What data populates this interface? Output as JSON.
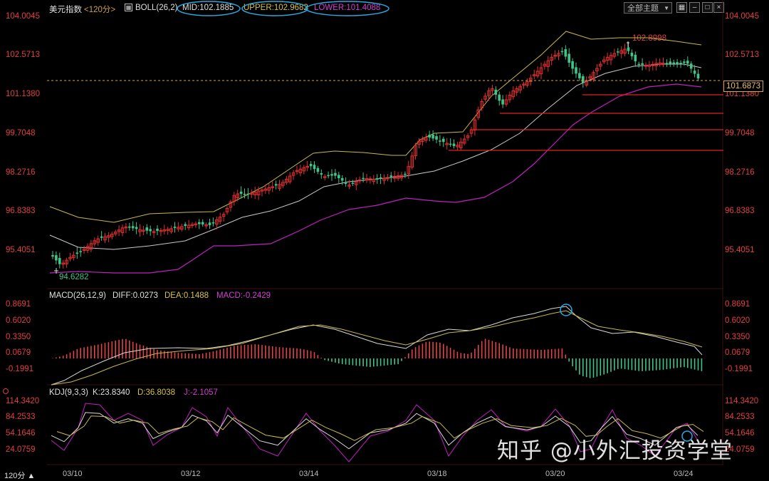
{
  "main_panel": {
    "indicator_name": "美元指数",
    "period": "<120分>",
    "boll_label": "BOLL(26,2)",
    "mid": "MID:102.1885",
    "upper": "UPPER:102.9682",
    "lower": "LOWER:101.4088",
    "high_annotation": "102.8998",
    "low_annotation": "94.6282",
    "current_price": "101.6873",
    "axis_left": [
      "104.0045",
      "102.5713",
      "101.1380",
      "99.7048",
      "98.2716",
      "96.8383",
      "95.4051"
    ],
    "axis_right": [
      "104.0045",
      "102.5713",
      "101.1380",
      "99.7048",
      "98.2716",
      "96.8383",
      "95.4051"
    ]
  },
  "toolbar": {
    "theme_select": "全部主题",
    "theme_arrow": "▼"
  },
  "macd_panel": {
    "label": "MACD(26,12,9)",
    "diff": "DIFF:0.0273",
    "dea": "DEA:0.1488",
    "macd": "MACD:-0.2429",
    "axis": [
      "0.8691",
      "0.6020",
      "0.3350",
      "0.0679",
      "-0.1991"
    ]
  },
  "kdj_panel": {
    "label": "KDJ(9,3,3)",
    "k": "K:23.8340",
    "d": "D:36.8038",
    "j": "J:-2.1057",
    "axis": [
      "114.3420",
      "84.2533",
      "54.1646",
      "24.0759"
    ]
  },
  "bottom_bar": {
    "period_button": "120分 ▲",
    "dates": [
      "03/10",
      "03/12",
      "03/14",
      "03/18",
      "03/20",
      "03/24"
    ]
  },
  "watermark": "知乎 @小外汇投资学堂",
  "colors": {
    "up": "#e03030",
    "down": "#3fc58a",
    "mid_line": "#c8c8c8",
    "upper_line": "#c8b84a",
    "lower_line": "#c020c0",
    "axis_text": "#e04040",
    "highlight_circle": "#2aa8e0"
  }
}
